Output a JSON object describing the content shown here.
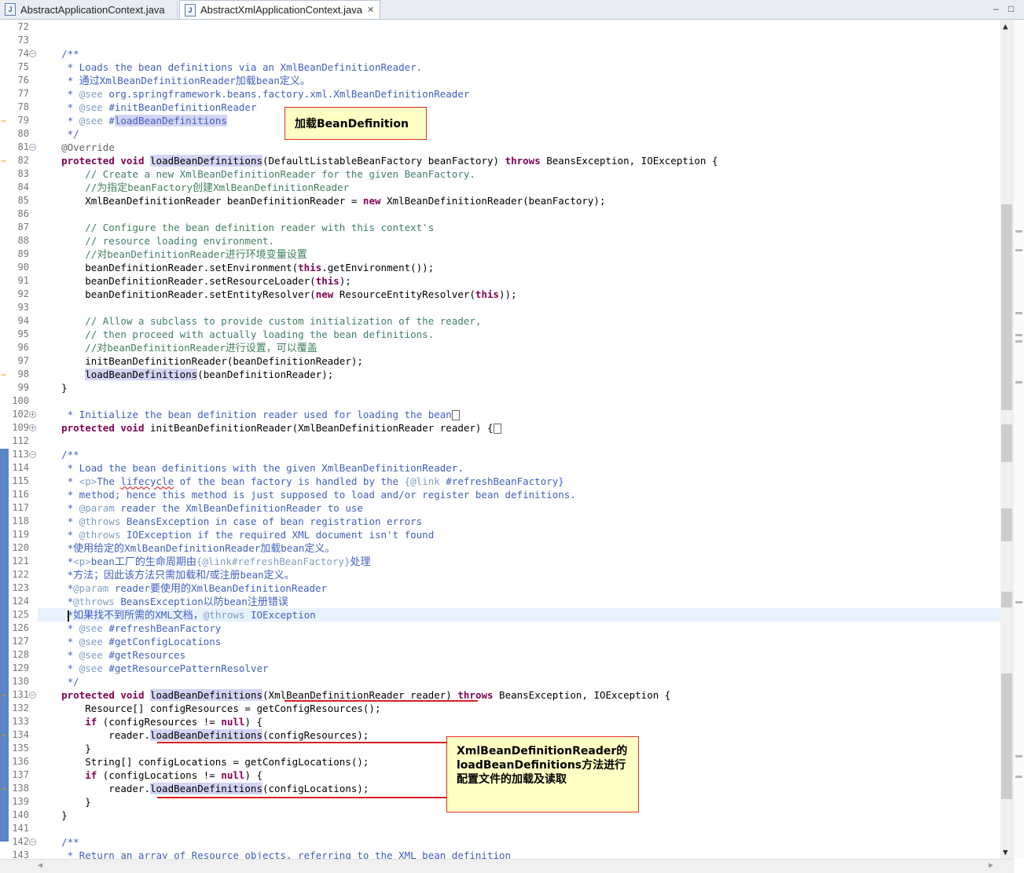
{
  "tabs": [
    {
      "label": "AbstractApplicationContext.java",
      "active": false
    },
    {
      "label": "AbstractXmlApplicationContext.java",
      "active": true
    }
  ],
  "window_controls": {
    "minimize": "–",
    "maximize": "□"
  },
  "annotations": {
    "note1": "加载BeanDefinition",
    "note2_line1": "XmlBeanDefinitionReader的",
    "note2_line2": "loadBeanDefinitions方法进行",
    "note2_line3": "配置文件的加载及读取"
  },
  "colors": {
    "keyword": "#7f0055",
    "javadoc": "#3f5fbf",
    "comment": "#3f7f5f",
    "highlight": "#d4d4f5",
    "annotation_border": "#e03030",
    "annotation_bg": "#ffffc4"
  },
  "code_lines": [
    {
      "n": "72",
      "tokens": []
    },
    {
      "n": "73",
      "tokens": []
    },
    {
      "n": "74",
      "fold": "minus",
      "tokens": [
        [
          "    ",
          ""
        ],
        [
          "/**",
          "doc"
        ]
      ]
    },
    {
      "n": "75",
      "tokens": [
        [
          "     * Loads the bean definitions via an XmlBeanDefinitionReader.",
          "doc"
        ]
      ]
    },
    {
      "n": "76",
      "tokens": [
        [
          "     * ",
          "doc"
        ],
        [
          "通过",
          "cn"
        ],
        [
          "XmlBeanDefinitionReader",
          "doc"
        ],
        [
          "加载",
          "cn"
        ],
        [
          "bean",
          "doc"
        ],
        [
          "定义。",
          "cn"
        ]
      ]
    },
    {
      "n": "77",
      "tokens": [
        [
          "     * ",
          "doc"
        ],
        [
          "@see",
          "tag"
        ],
        [
          " org.springframework.beans.factory.xml.XmlBeanDefinitionReader",
          "doc"
        ]
      ]
    },
    {
      "n": "78",
      "tokens": [
        [
          "     * ",
          "doc"
        ],
        [
          "@see",
          "tag"
        ],
        [
          " #initBeanDefinitionReader",
          "doc"
        ]
      ]
    },
    {
      "n": "79",
      "arrow": true,
      "tokens": [
        [
          "     * ",
          "doc"
        ],
        [
          "@see",
          "tag"
        ],
        [
          " #",
          "doc"
        ],
        [
          "loadBeanDefinitions",
          "doc hl"
        ]
      ]
    },
    {
      "n": "80",
      "tokens": [
        [
          "     */",
          "doc"
        ]
      ]
    },
    {
      "n": "81",
      "fold": "minus",
      "tokens": [
        [
          "    ",
          ""
        ],
        [
          "@Override",
          "ann"
        ]
      ]
    },
    {
      "n": "82",
      "arrow": true,
      "tokens": [
        [
          "    ",
          ""
        ],
        [
          "protected",
          "kw"
        ],
        [
          " ",
          ""
        ],
        [
          "void",
          "kw"
        ],
        [
          " ",
          ""
        ],
        [
          "loadBeanDefinitions",
          "hl"
        ],
        [
          "(DefaultListableBeanFactory beanFactory) ",
          ""
        ],
        [
          "throws",
          "kw"
        ],
        [
          " BeansException, IOException {",
          ""
        ]
      ]
    },
    {
      "n": "83",
      "tokens": [
        [
          "        // Create a new XmlBeanDefinitionReader for the given BeanFactory.",
          "cm"
        ]
      ]
    },
    {
      "n": "84",
      "tokens": [
        [
          "        //",
          "cm"
        ],
        [
          "为指定",
          "cnc"
        ],
        [
          "beanFactory",
          "cm"
        ],
        [
          "创建",
          "cnc"
        ],
        [
          "XmlBeanDefinitionReader",
          "cm"
        ]
      ]
    },
    {
      "n": "85",
      "tokens": [
        [
          "        XmlBeanDefinitionReader beanDefinitionReader = ",
          ""
        ],
        [
          "new",
          "kw"
        ],
        [
          " XmlBeanDefinitionReader(beanFactory);",
          ""
        ]
      ]
    },
    {
      "n": "86",
      "tokens": []
    },
    {
      "n": "87",
      "tokens": [
        [
          "        // Configure the bean definition reader with this context's",
          "cm"
        ]
      ]
    },
    {
      "n": "88",
      "tokens": [
        [
          "        // resource loading environment.",
          "cm"
        ]
      ]
    },
    {
      "n": "89",
      "tokens": [
        [
          "        //",
          "cm"
        ],
        [
          "对",
          "cnc"
        ],
        [
          "beanDefinitionReader",
          "cm"
        ],
        [
          "进行环境变量设置",
          "cnc"
        ]
      ]
    },
    {
      "n": "90",
      "tokens": [
        [
          "        beanDefinitionReader.setEnvironment(",
          ""
        ],
        [
          "this",
          "kw"
        ],
        [
          ".getEnvironment());",
          ""
        ]
      ]
    },
    {
      "n": "91",
      "tokens": [
        [
          "        beanDefinitionReader.setResourceLoader(",
          ""
        ],
        [
          "this",
          "kw"
        ],
        [
          ");",
          ""
        ]
      ]
    },
    {
      "n": "92",
      "tokens": [
        [
          "        beanDefinitionReader.setEntityResolver(",
          ""
        ],
        [
          "new",
          "kw"
        ],
        [
          " ResourceEntityResolver(",
          ""
        ],
        [
          "this",
          "kw"
        ],
        [
          "));",
          ""
        ]
      ]
    },
    {
      "n": "93",
      "tokens": []
    },
    {
      "n": "94",
      "tokens": [
        [
          "        // Allow a subclass to provide custom initialization of the reader,",
          "cm"
        ]
      ]
    },
    {
      "n": "95",
      "tokens": [
        [
          "        // then proceed with actually loading the bean definitions.",
          "cm"
        ]
      ]
    },
    {
      "n": "96",
      "tokens": [
        [
          "        //",
          "cm"
        ],
        [
          "对",
          "cnc"
        ],
        [
          "beanDefinitionReader",
          "cm"
        ],
        [
          "进行设置，可以覆盖",
          "cnc"
        ]
      ]
    },
    {
      "n": "97",
      "tokens": [
        [
          "        initBeanDefinitionReader(beanDefinitionReader);",
          ""
        ]
      ]
    },
    {
      "n": "98",
      "arrow": true,
      "tokens": [
        [
          "        ",
          ""
        ],
        [
          "loadBeanDefinitions",
          "hl"
        ],
        [
          "(beanDefinitionReader);",
          ""
        ]
      ]
    },
    {
      "n": "99",
      "tokens": [
        [
          "    }",
          ""
        ]
      ]
    },
    {
      "n": "100",
      "tokens": []
    },
    {
      "n": "102",
      "fold": "plus",
      "tokens": [
        [
          "     * Initialize the bean definition reader used for loading the bean",
          "doc"
        ],
        [
          "",
          "box"
        ]
      ]
    },
    {
      "n": "109",
      "fold": "plus",
      "tokens": [
        [
          "    ",
          ""
        ],
        [
          "protected",
          "kw"
        ],
        [
          " ",
          ""
        ],
        [
          "void",
          "kw"
        ],
        [
          " initBeanDefinitionReader(XmlBeanDefinitionReader reader) {",
          ""
        ],
        [
          "",
          "box"
        ]
      ]
    },
    {
      "n": "112",
      "tokens": []
    },
    {
      "n": "113",
      "fold": "minus",
      "tokens": [
        [
          "    ",
          ""
        ],
        [
          "/**",
          "doc"
        ]
      ]
    },
    {
      "n": "114",
      "tokens": [
        [
          "     * Load the bean definitions with the given XmlBeanDefinitionReader.",
          "doc"
        ]
      ]
    },
    {
      "n": "115",
      "tokens": [
        [
          "     * ",
          "doc"
        ],
        [
          "<p>",
          "tag"
        ],
        [
          "The ",
          "doc"
        ],
        [
          "lifecycle",
          "doc uline"
        ],
        [
          " of the bean factory is handled by the ",
          "doc"
        ],
        [
          "{@link",
          "tag"
        ],
        [
          " #refreshBeanFactory}",
          "doc"
        ]
      ]
    },
    {
      "n": "116",
      "tokens": [
        [
          "     * method; hence this method is just supposed to load and/or register bean definitions.",
          "doc"
        ]
      ]
    },
    {
      "n": "117",
      "tokens": [
        [
          "     * ",
          "doc"
        ],
        [
          "@param",
          "tag"
        ],
        [
          " reader the XmlBeanDefinitionReader to use",
          "doc"
        ]
      ]
    },
    {
      "n": "118",
      "tokens": [
        [
          "     * ",
          "doc"
        ],
        [
          "@throws",
          "tag"
        ],
        [
          " BeansException in case of bean registration errors",
          "doc"
        ]
      ]
    },
    {
      "n": "119",
      "tokens": [
        [
          "     * ",
          "doc"
        ],
        [
          "@throws",
          "tag"
        ],
        [
          " IOException if the required XML document isn't found",
          "doc"
        ]
      ]
    },
    {
      "n": "120",
      "tokens": [
        [
          "     *",
          "doc"
        ],
        [
          "使用给定的",
          "cn"
        ],
        [
          "XmlBeanDefinitionReader",
          "doc"
        ],
        [
          "加载",
          "cn"
        ],
        [
          "bean",
          "doc"
        ],
        [
          "定义。",
          "cn"
        ]
      ]
    },
    {
      "n": "121",
      "tokens": [
        [
          "     *",
          "doc"
        ],
        [
          "<p>",
          "tag"
        ],
        [
          "bean",
          "doc"
        ],
        [
          "工厂的生命周期由",
          "cn"
        ],
        [
          "{@link#refreshBeanFactory}",
          "tag"
        ],
        [
          "处理",
          "cn"
        ]
      ]
    },
    {
      "n": "122",
      "tokens": [
        [
          "     *",
          "doc"
        ],
        [
          "方法；因此该方法只需加载和/或注册",
          "cn"
        ],
        [
          "bean",
          "doc"
        ],
        [
          "定义。",
          "cn"
        ]
      ]
    },
    {
      "n": "123",
      "tokens": [
        [
          "     *",
          "doc"
        ],
        [
          "@param",
          "tag"
        ],
        [
          " reader",
          "doc"
        ],
        [
          "要使用的",
          "cn"
        ],
        [
          "XmlBeanDefinitionReader",
          "doc"
        ]
      ]
    },
    {
      "n": "124",
      "tokens": [
        [
          "     *",
          "doc"
        ],
        [
          "@throws",
          "tag"
        ],
        [
          " BeansException",
          "doc"
        ],
        [
          "以防",
          "cn"
        ],
        [
          "bean",
          "doc"
        ],
        [
          "注册错误",
          "cn"
        ]
      ]
    },
    {
      "n": "125",
      "current": true,
      "tokens": [
        [
          "     ",
          ""
        ],
        [
          "",
          "cursor"
        ],
        [
          "*",
          "doc"
        ],
        [
          "如果找不到所需的",
          "cn"
        ],
        [
          "XML",
          "doc"
        ],
        [
          "文档，",
          "cn"
        ],
        [
          "@throws",
          "tag"
        ],
        [
          " IOException",
          "doc"
        ]
      ]
    },
    {
      "n": "126",
      "tokens": [
        [
          "     * ",
          "doc"
        ],
        [
          "@see",
          "tag"
        ],
        [
          " #refreshBeanFactory",
          "doc"
        ]
      ]
    },
    {
      "n": "127",
      "tokens": [
        [
          "     * ",
          "doc"
        ],
        [
          "@see",
          "tag"
        ],
        [
          " #getConfigLocations",
          "doc"
        ]
      ]
    },
    {
      "n": "128",
      "tokens": [
        [
          "     * ",
          "doc"
        ],
        [
          "@see",
          "tag"
        ],
        [
          " #getResources",
          "doc"
        ]
      ]
    },
    {
      "n": "129",
      "tokens": [
        [
          "     * ",
          "doc"
        ],
        [
          "@see",
          "tag"
        ],
        [
          " #getResourcePatternResolver",
          "doc"
        ]
      ]
    },
    {
      "n": "130",
      "tokens": [
        [
          "     */",
          "doc"
        ]
      ]
    },
    {
      "n": "131",
      "fold": "minus",
      "arrow": true,
      "tokens": [
        [
          "    ",
          ""
        ],
        [
          "protected",
          "kw"
        ],
        [
          " ",
          ""
        ],
        [
          "void",
          "kw"
        ],
        [
          " ",
          ""
        ],
        [
          "loadBeanDefinitions",
          "hl"
        ],
        [
          "(XmlBeanDefinitionReader reader) ",
          ""
        ],
        [
          "throws",
          "kw"
        ],
        [
          " BeansException, IOException {",
          ""
        ]
      ]
    },
    {
      "n": "132",
      "tokens": [
        [
          "        Resource[] configResources = getConfigResources();",
          ""
        ]
      ]
    },
    {
      "n": "133",
      "tokens": [
        [
          "        ",
          ""
        ],
        [
          "if",
          "kw"
        ],
        [
          " (configResources != ",
          ""
        ],
        [
          "null",
          "kw"
        ],
        [
          ") {",
          ""
        ]
      ]
    },
    {
      "n": "134",
      "arrow": true,
      "tokens": [
        [
          "            reader.",
          ""
        ],
        [
          "loadBeanDefinitions",
          "hl"
        ],
        [
          "(configResources);",
          ""
        ]
      ]
    },
    {
      "n": "135",
      "tokens": [
        [
          "        }",
          ""
        ]
      ]
    },
    {
      "n": "136",
      "tokens": [
        [
          "        String[] configLocations = getConfigLocations();",
          ""
        ]
      ]
    },
    {
      "n": "137",
      "tokens": [
        [
          "        ",
          ""
        ],
        [
          "if",
          "kw"
        ],
        [
          " (configLocations != ",
          ""
        ],
        [
          "null",
          "kw"
        ],
        [
          ") {",
          ""
        ]
      ]
    },
    {
      "n": "138",
      "arrow": true,
      "tokens": [
        [
          "            reader.",
          ""
        ],
        [
          "loadBeanDefinitions",
          "hl"
        ],
        [
          "(configLocations);",
          ""
        ]
      ]
    },
    {
      "n": "139",
      "tokens": [
        [
          "        }",
          ""
        ]
      ]
    },
    {
      "n": "140",
      "tokens": [
        [
          "    }",
          ""
        ]
      ]
    },
    {
      "n": "141",
      "tokens": []
    },
    {
      "n": "142",
      "fold": "minus",
      "tokens": [
        [
          "    ",
          ""
        ],
        [
          "/**",
          "doc"
        ]
      ]
    },
    {
      "n": "143",
      "tokens": [
        [
          "     * Return an array of Resource objects, referring to the XML bean definition",
          "doc"
        ]
      ]
    }
  ]
}
